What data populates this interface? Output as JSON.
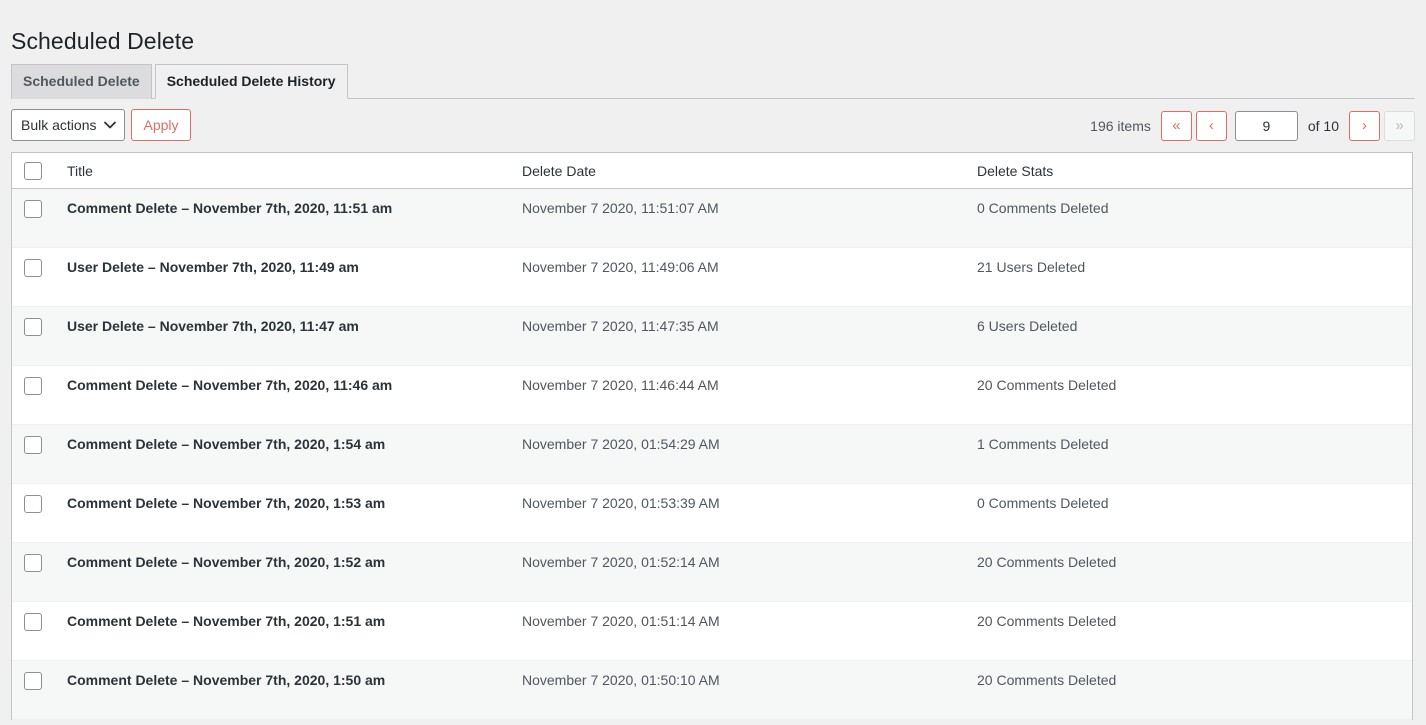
{
  "page": {
    "title": "Scheduled Delete"
  },
  "tabs": [
    {
      "label": "Scheduled Delete",
      "active": false
    },
    {
      "label": "Scheduled Delete History",
      "active": true
    }
  ],
  "toolbar": {
    "bulk_actions_label": "Bulk actions",
    "apply_label": "Apply",
    "chevron_icon": "chevron-down-icon"
  },
  "pagination": {
    "items_text": "196 items",
    "first_label": "«",
    "prev_label": "‹",
    "current_page": "9",
    "total_text": "of 10",
    "next_label": "›",
    "last_label": "»",
    "last_disabled": true
  },
  "table": {
    "columns": [
      "Title",
      "Delete Date",
      "Delete Stats"
    ],
    "rows": [
      {
        "title": "Comment Delete – November 7th, 2020, 11:51 am",
        "date": "November 7 2020, 11:51:07 AM",
        "stats": "0 Comments Deleted"
      },
      {
        "title": "User Delete – November 7th, 2020, 11:49 am",
        "date": "November 7 2020, 11:49:06 AM",
        "stats": "21 Users Deleted"
      },
      {
        "title": "User Delete – November 7th, 2020, 11:47 am",
        "date": "November 7 2020, 11:47:35 AM",
        "stats": "6 Users Deleted"
      },
      {
        "title": "Comment Delete – November 7th, 2020, 11:46 am",
        "date": "November 7 2020, 11:46:44 AM",
        "stats": "20 Comments Deleted"
      },
      {
        "title": "Comment Delete – November 7th, 2020, 1:54 am",
        "date": "November 7 2020, 01:54:29 AM",
        "stats": "1 Comments Deleted"
      },
      {
        "title": "Comment Delete – November 7th, 2020, 1:53 am",
        "date": "November 7 2020, 01:53:39 AM",
        "stats": "0 Comments Deleted"
      },
      {
        "title": "Comment Delete – November 7th, 2020, 1:52 am",
        "date": "November 7 2020, 01:52:14 AM",
        "stats": "20 Comments Deleted"
      },
      {
        "title": "Comment Delete – November 7th, 2020, 1:51 am",
        "date": "November 7 2020, 01:51:14 AM",
        "stats": "20 Comments Deleted"
      },
      {
        "title": "Comment Delete – November 7th, 2020, 1:50 am",
        "date": "November 7 2020, 01:50:10 AM",
        "stats": "20 Comments Deleted"
      }
    ]
  },
  "colors": {
    "accent": "#e06d64",
    "page_bg": "#f0f0f1",
    "text": "#2c3338",
    "muted": "#50575e",
    "row_alt": "#f6f7f7"
  }
}
